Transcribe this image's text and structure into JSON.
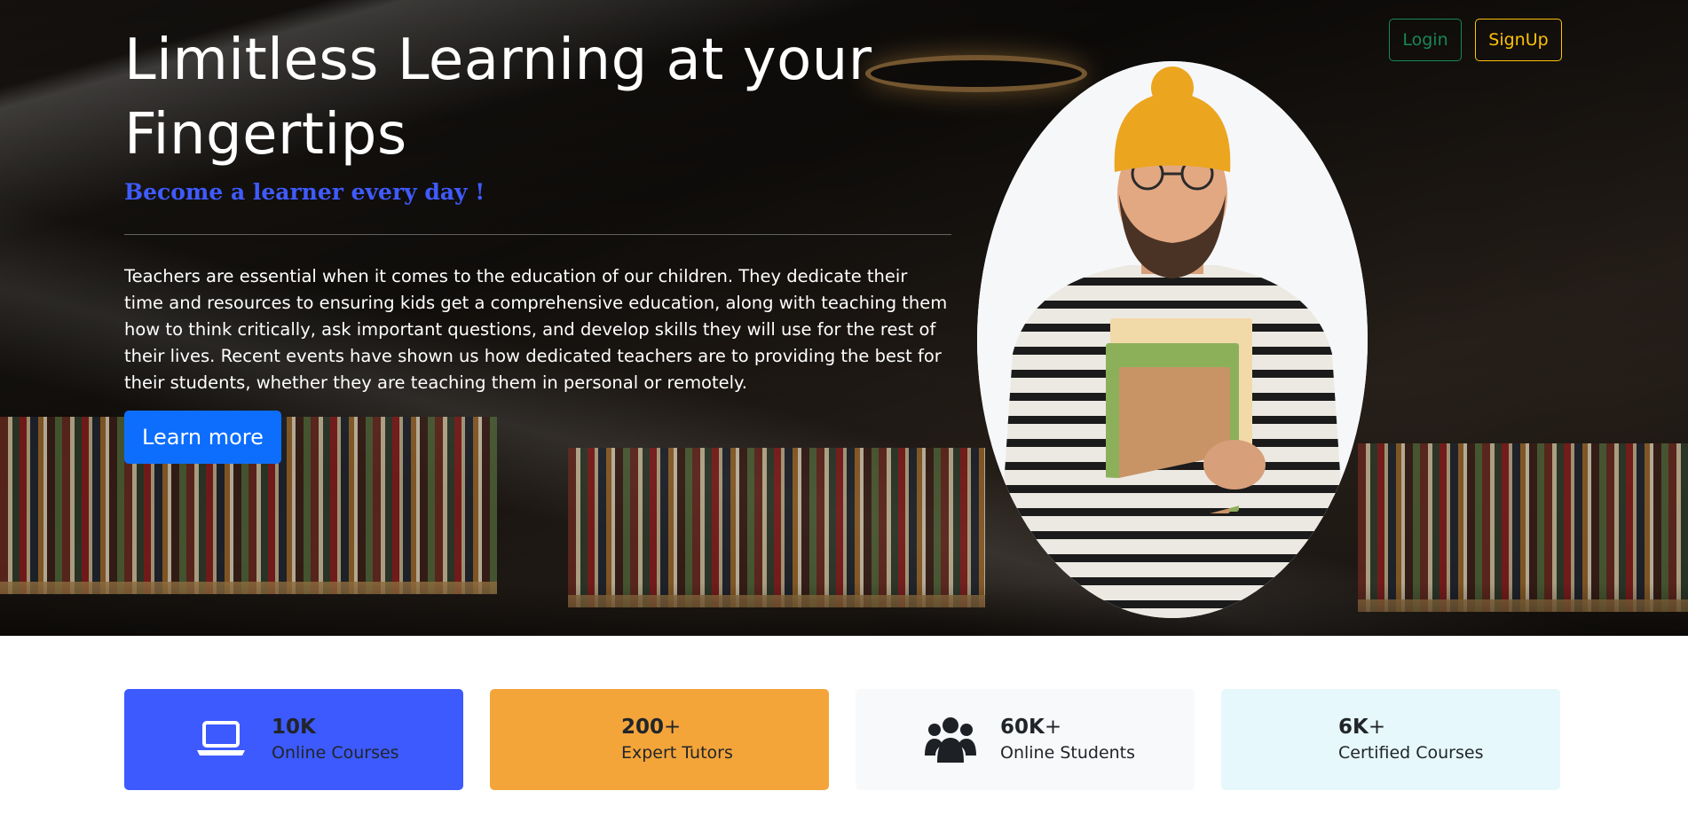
{
  "hero": {
    "title": "Limitless Learning at your Fingertips",
    "tagline": "Become a learner every day !",
    "body": "Teachers are essential when it comes to the education of our children. They dedicate their time and resources to ensuring kids get a comprehensive education, along with teaching them how to think critically, ask important questions, and develop skills they will use for the rest of their lives. Recent events have shown us how dedicated teachers are to providing the best for their students, whether they are teaching them in personal or remotely.",
    "cta_label": "Learn more"
  },
  "auth": {
    "login_label": "Login",
    "signup_label": "SignUp"
  },
  "stats": [
    {
      "number": "10K",
      "suffix": "",
      "label": "Online Courses",
      "icon": "laptop-icon",
      "bg": "#3d5afe"
    },
    {
      "number": "200",
      "suffix": "+",
      "label": "Expert Tutors",
      "icon": "",
      "bg": "#f4a53a"
    },
    {
      "number": "60K",
      "suffix": "+",
      "label": "Online Students",
      "icon": "users-icon",
      "bg": "#f8f9fa"
    },
    {
      "number": "6K",
      "suffix": "+",
      "label": "Certified Courses",
      "icon": "",
      "bg": "#e6f8fb"
    }
  ],
  "colors": {
    "primary": "#0d6efd",
    "success": "#198754",
    "warning": "#ffc107",
    "tagline": "#3f5bff"
  }
}
